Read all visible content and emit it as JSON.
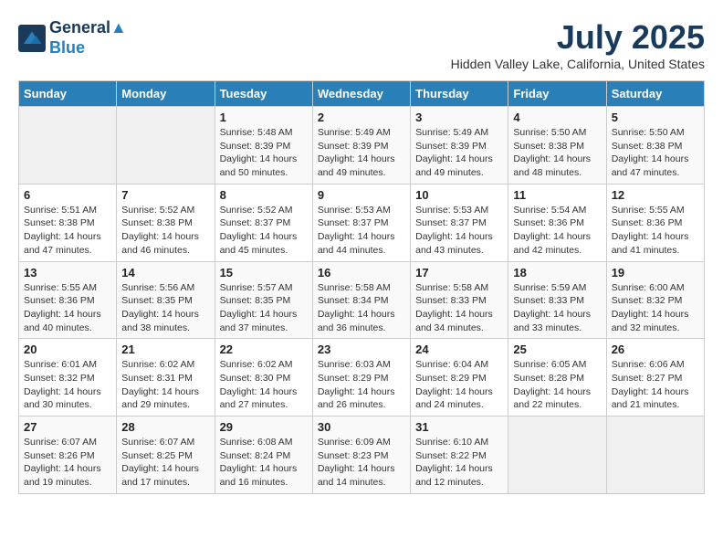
{
  "header": {
    "logo_line1": "General",
    "logo_line2": "Blue",
    "month_year": "July 2025",
    "location": "Hidden Valley Lake, California, United States"
  },
  "weekdays": [
    "Sunday",
    "Monday",
    "Tuesday",
    "Wednesday",
    "Thursday",
    "Friday",
    "Saturday"
  ],
  "weeks": [
    [
      {
        "day": "",
        "info": ""
      },
      {
        "day": "",
        "info": ""
      },
      {
        "day": "1",
        "info": "Sunrise: 5:48 AM\nSunset: 8:39 PM\nDaylight: 14 hours and 50 minutes."
      },
      {
        "day": "2",
        "info": "Sunrise: 5:49 AM\nSunset: 8:39 PM\nDaylight: 14 hours and 49 minutes."
      },
      {
        "day": "3",
        "info": "Sunrise: 5:49 AM\nSunset: 8:39 PM\nDaylight: 14 hours and 49 minutes."
      },
      {
        "day": "4",
        "info": "Sunrise: 5:50 AM\nSunset: 8:38 PM\nDaylight: 14 hours and 48 minutes."
      },
      {
        "day": "5",
        "info": "Sunrise: 5:50 AM\nSunset: 8:38 PM\nDaylight: 14 hours and 47 minutes."
      }
    ],
    [
      {
        "day": "6",
        "info": "Sunrise: 5:51 AM\nSunset: 8:38 PM\nDaylight: 14 hours and 47 minutes."
      },
      {
        "day": "7",
        "info": "Sunrise: 5:52 AM\nSunset: 8:38 PM\nDaylight: 14 hours and 46 minutes."
      },
      {
        "day": "8",
        "info": "Sunrise: 5:52 AM\nSunset: 8:37 PM\nDaylight: 14 hours and 45 minutes."
      },
      {
        "day": "9",
        "info": "Sunrise: 5:53 AM\nSunset: 8:37 PM\nDaylight: 14 hours and 44 minutes."
      },
      {
        "day": "10",
        "info": "Sunrise: 5:53 AM\nSunset: 8:37 PM\nDaylight: 14 hours and 43 minutes."
      },
      {
        "day": "11",
        "info": "Sunrise: 5:54 AM\nSunset: 8:36 PM\nDaylight: 14 hours and 42 minutes."
      },
      {
        "day": "12",
        "info": "Sunrise: 5:55 AM\nSunset: 8:36 PM\nDaylight: 14 hours and 41 minutes."
      }
    ],
    [
      {
        "day": "13",
        "info": "Sunrise: 5:55 AM\nSunset: 8:36 PM\nDaylight: 14 hours and 40 minutes."
      },
      {
        "day": "14",
        "info": "Sunrise: 5:56 AM\nSunset: 8:35 PM\nDaylight: 14 hours and 38 minutes."
      },
      {
        "day": "15",
        "info": "Sunrise: 5:57 AM\nSunset: 8:35 PM\nDaylight: 14 hours and 37 minutes."
      },
      {
        "day": "16",
        "info": "Sunrise: 5:58 AM\nSunset: 8:34 PM\nDaylight: 14 hours and 36 minutes."
      },
      {
        "day": "17",
        "info": "Sunrise: 5:58 AM\nSunset: 8:33 PM\nDaylight: 14 hours and 34 minutes."
      },
      {
        "day": "18",
        "info": "Sunrise: 5:59 AM\nSunset: 8:33 PM\nDaylight: 14 hours and 33 minutes."
      },
      {
        "day": "19",
        "info": "Sunrise: 6:00 AM\nSunset: 8:32 PM\nDaylight: 14 hours and 32 minutes."
      }
    ],
    [
      {
        "day": "20",
        "info": "Sunrise: 6:01 AM\nSunset: 8:32 PM\nDaylight: 14 hours and 30 minutes."
      },
      {
        "day": "21",
        "info": "Sunrise: 6:02 AM\nSunset: 8:31 PM\nDaylight: 14 hours and 29 minutes."
      },
      {
        "day": "22",
        "info": "Sunrise: 6:02 AM\nSunset: 8:30 PM\nDaylight: 14 hours and 27 minutes."
      },
      {
        "day": "23",
        "info": "Sunrise: 6:03 AM\nSunset: 8:29 PM\nDaylight: 14 hours and 26 minutes."
      },
      {
        "day": "24",
        "info": "Sunrise: 6:04 AM\nSunset: 8:29 PM\nDaylight: 14 hours and 24 minutes."
      },
      {
        "day": "25",
        "info": "Sunrise: 6:05 AM\nSunset: 8:28 PM\nDaylight: 14 hours and 22 minutes."
      },
      {
        "day": "26",
        "info": "Sunrise: 6:06 AM\nSunset: 8:27 PM\nDaylight: 14 hours and 21 minutes."
      }
    ],
    [
      {
        "day": "27",
        "info": "Sunrise: 6:07 AM\nSunset: 8:26 PM\nDaylight: 14 hours and 19 minutes."
      },
      {
        "day": "28",
        "info": "Sunrise: 6:07 AM\nSunset: 8:25 PM\nDaylight: 14 hours and 17 minutes."
      },
      {
        "day": "29",
        "info": "Sunrise: 6:08 AM\nSunset: 8:24 PM\nDaylight: 14 hours and 16 minutes."
      },
      {
        "day": "30",
        "info": "Sunrise: 6:09 AM\nSunset: 8:23 PM\nDaylight: 14 hours and 14 minutes."
      },
      {
        "day": "31",
        "info": "Sunrise: 6:10 AM\nSunset: 8:22 PM\nDaylight: 14 hours and 12 minutes."
      },
      {
        "day": "",
        "info": ""
      },
      {
        "day": "",
        "info": ""
      }
    ]
  ]
}
